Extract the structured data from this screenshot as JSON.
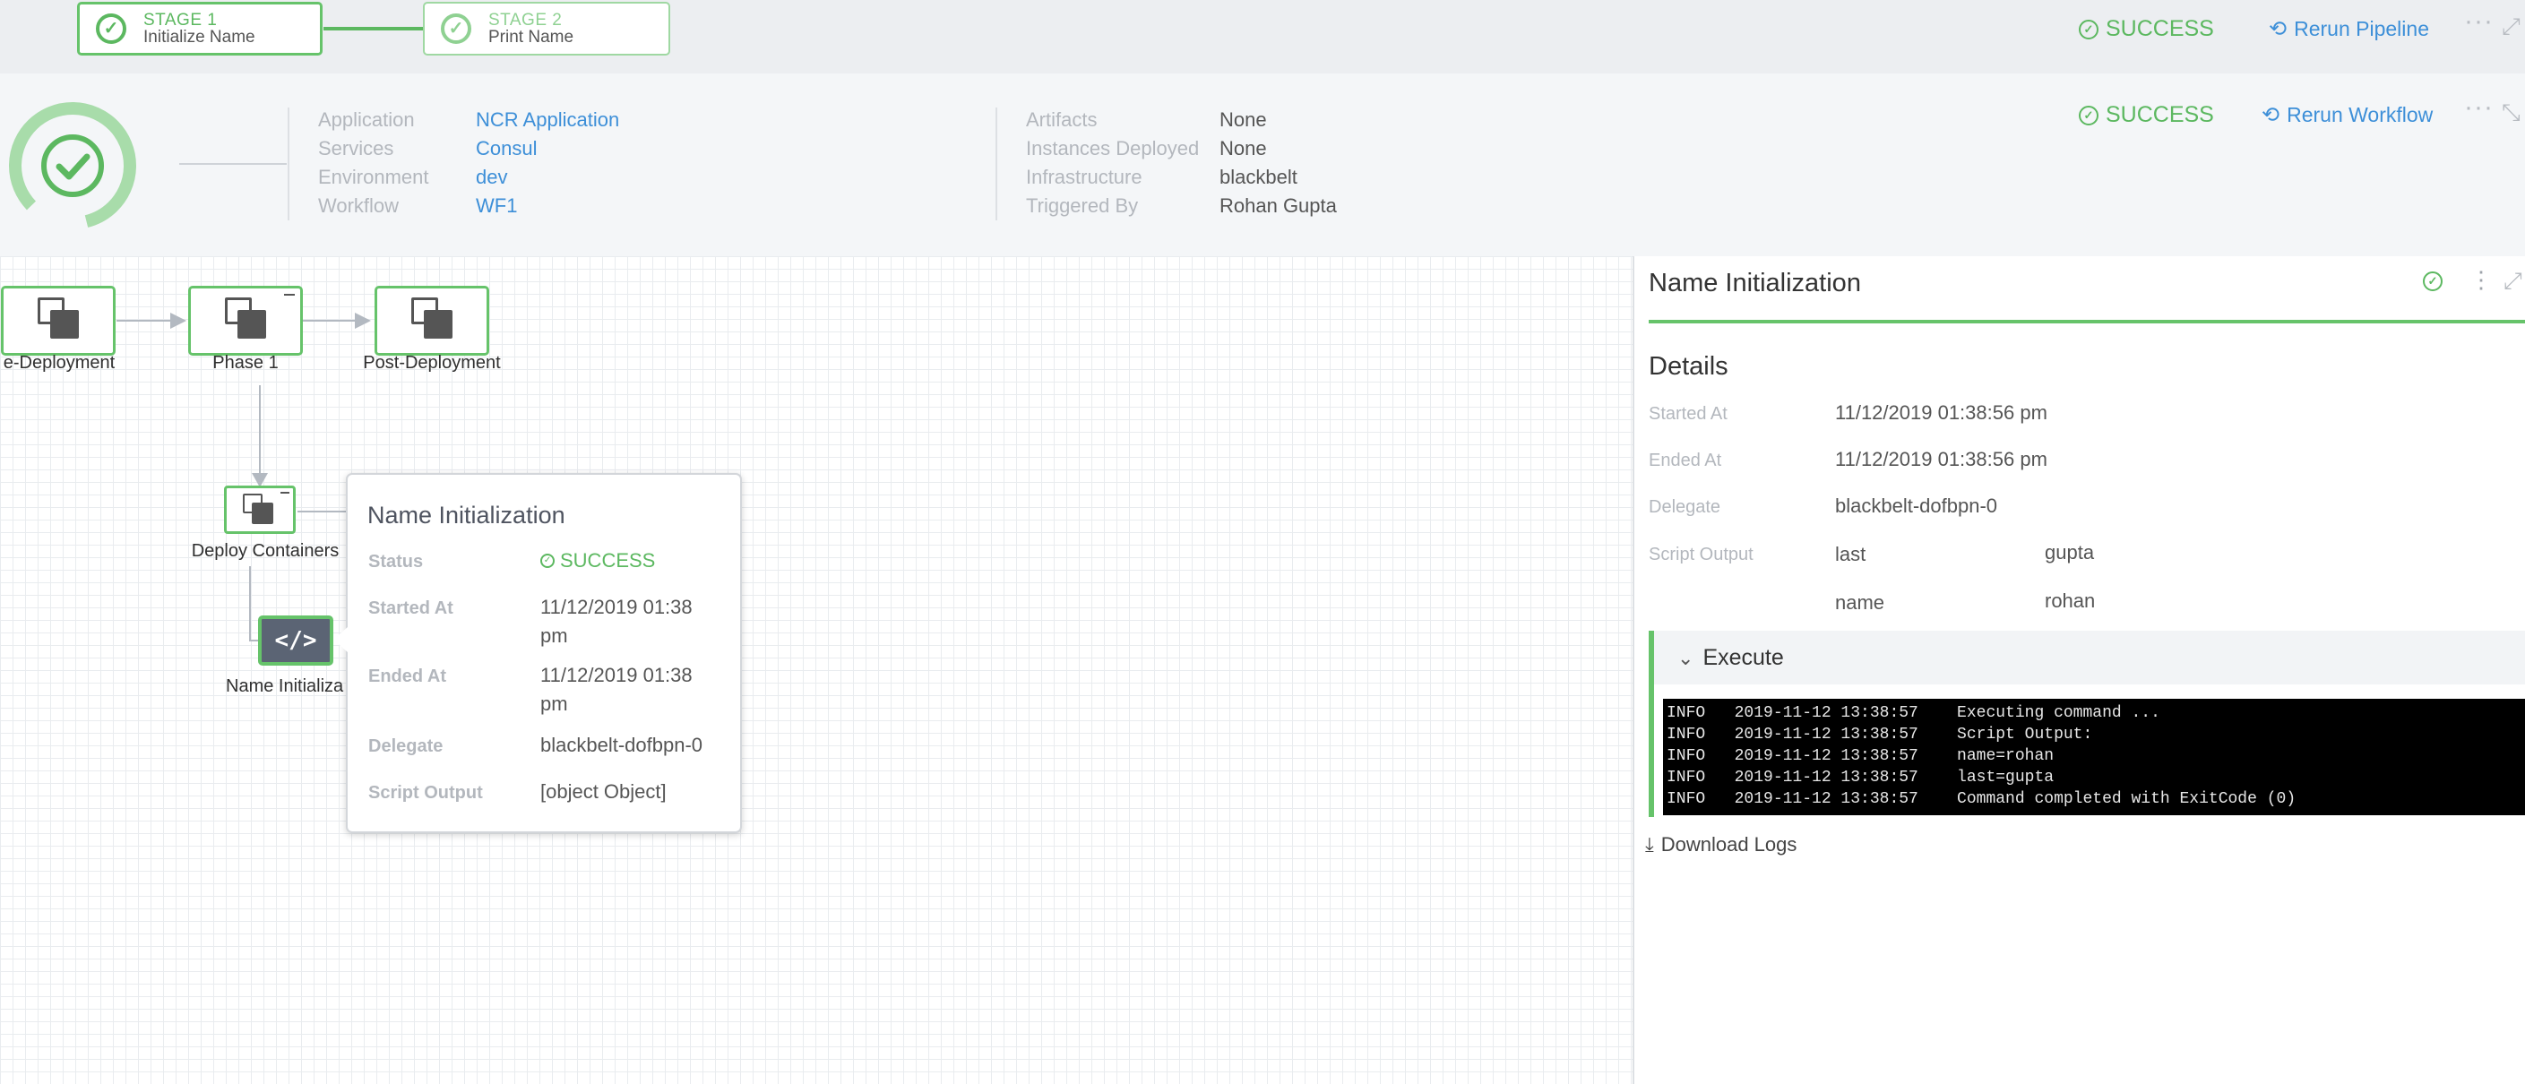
{
  "pipeline": {
    "stages": [
      {
        "number": "STAGE 1",
        "name": "Initialize Name"
      },
      {
        "number": "STAGE 2",
        "name": "Print Name"
      }
    ],
    "status": "SUCCESS",
    "rerun_label": "Rerun Pipeline"
  },
  "workflow_summary": {
    "left": [
      {
        "label": "Application",
        "value": "NCR Application"
      },
      {
        "label": "Services",
        "value": "Consul"
      },
      {
        "label": "Environment",
        "value": "dev"
      },
      {
        "label": "Workflow",
        "value": "WF1"
      }
    ],
    "right": [
      {
        "label": "Artifacts",
        "value": "None"
      },
      {
        "label": "Instances Deployed",
        "value": "None"
      },
      {
        "label": "Infrastructure",
        "value": "blackbelt"
      },
      {
        "label": "Triggered By",
        "value": "Rohan Gupta"
      }
    ],
    "status": "SUCCESS",
    "rerun_label": "Rerun Workflow"
  },
  "graph": {
    "nodes": {
      "pre_deployment": "e-Deployment",
      "phase1": "Phase 1",
      "post_deployment": "Post-Deployment",
      "deploy_containers": "Deploy Containers",
      "name_init": "Name Initializa"
    },
    "script_glyph": "</>"
  },
  "popover": {
    "title": "Name Initialization",
    "rows": {
      "status_label": "Status",
      "status_value": "SUCCESS",
      "started_label": "Started At",
      "started_value_1": "11/12/2019 01:38",
      "started_value_2": "pm",
      "ended_label": "Ended At",
      "ended_value_1": "11/12/2019 01:38",
      "ended_value_2": "pm",
      "delegate_label": "Delegate",
      "delegate_value": "blackbelt-dofbpn-0",
      "script_label": "Script Output",
      "script_value": "[object Object]"
    }
  },
  "details_panel": {
    "title": "Name Initialization",
    "section": "Details",
    "started_label": "Started At",
    "started_value": "11/12/2019 01:38:56 pm",
    "ended_label": "Ended At",
    "ended_value": "11/12/2019 01:38:56 pm",
    "delegate_label": "Delegate",
    "delegate_value": "blackbelt-dofbpn-0",
    "script_output_label": "Script Output",
    "script_output": [
      {
        "key": "last",
        "value": "gupta"
      },
      {
        "key": "name",
        "value": "rohan"
      }
    ],
    "execute_label": "Execute",
    "logs": [
      "INFO   2019-11-12 13:38:57    Executing command ...",
      "INFO   2019-11-12 13:38:57    Script Output:",
      "INFO   2019-11-12 13:38:57    name=rohan",
      "INFO   2019-11-12 13:38:57    last=gupta",
      "INFO   2019-11-12 13:38:57    Command completed with ExitCode (0)"
    ],
    "download_label": "Download Logs"
  },
  "colors": {
    "success": "#5cb860",
    "link": "#3d8fd8",
    "stage_border": "#66c36a"
  },
  "icons": {
    "check": "check-circle",
    "rerun": "refresh",
    "more": "ellipsis",
    "expand": "expand",
    "collapse": "chevron-down",
    "download": "download"
  }
}
